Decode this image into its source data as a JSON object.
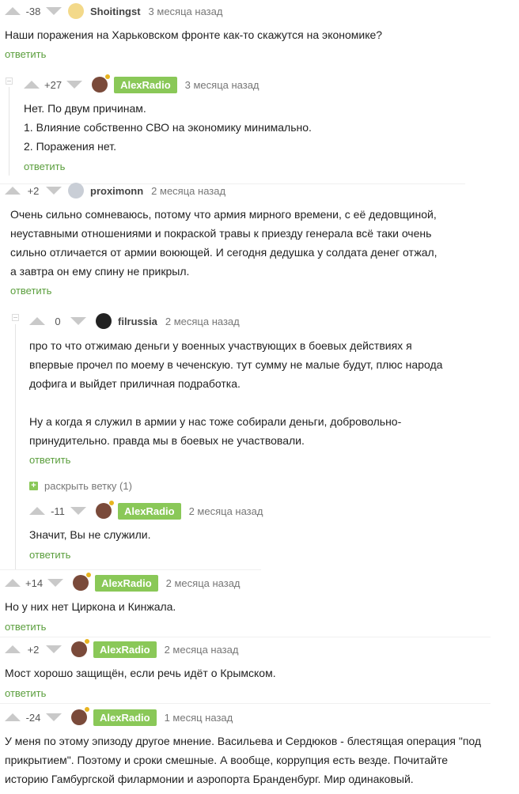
{
  "c1": {
    "rating": "-38",
    "user": "Shoitingst",
    "time": "3 месяца назад",
    "text": "Наши поражения на Харьковском фронте как-то скажутся на экономике?",
    "reply": "ответить"
  },
  "c2": {
    "rating": "+27",
    "user": "AlexRadio",
    "time": "3 месяца назад",
    "lines": [
      "Нет. По двум причинам.",
      "1. Влияние собственно СВО на экономику минимально.",
      "2. Поражения нет."
    ],
    "reply": "ответить"
  },
  "c3": {
    "rating": "+2",
    "user": "proximonn",
    "time": "2 месяца назад",
    "lines": [
      "Очень сильно сомневаюсь, потому что армия мирного времени, с её дедовщиной,",
      "неуставными отношениями и покраской травы к приезду генерала всё таки очень",
      "сильно отличается от армии воюющей. И сегодня дедушка у солдата денег отжал,",
      "а завтра он ему спину не прикрыл."
    ],
    "reply": "ответить"
  },
  "c4": {
    "rating": "0",
    "user": "filrussia",
    "time": "2 месяца назад",
    "lines": [
      "про то что отжимаю деньги у военных участвующих в боевых действиях я",
      "впервые прочел по моему в чеченскую. тут сумму не малые будут, плюс народа",
      "дофига и выйдет приличная подработка."
    ],
    "lines2": [
      "Ну а когда я служил в армии у нас тоже собирали деньги, добровольно-",
      "принудительно. правда мы в боевых не участвовали."
    ],
    "reply": "ответить",
    "expand": "раскрыть ветку (1)"
  },
  "c5": {
    "rating": "-11",
    "user": "AlexRadio",
    "time": "2 месяца назад",
    "text": "Значит, Вы не служили.",
    "reply": "ответить"
  },
  "c6": {
    "rating": "+14",
    "user": "AlexRadio",
    "time": "2 месяца назад",
    "text": "Но у них нет Циркона и Кинжала.",
    "reply": "ответить"
  },
  "c7": {
    "rating": "+2",
    "user": "AlexRadio",
    "time": "2 месяца назад",
    "text": "Мост хорошо защищён, если речь идёт о Крымском.",
    "reply": "ответить"
  },
  "c8": {
    "rating": "-24",
    "user": "AlexRadio",
    "time": "1 месяц назад",
    "lines": [
      "У меня по этому эпизоду другое мнение. Васильева и Сердюков - блестящая операция \"под",
      "прикрытием\". Поэтому и сроки смешные. А вообще, коррупция есть везде. Почитайте",
      "историю Гамбургской филармонии и аэропорта Бранденбург. Мир одинаковый."
    ]
  },
  "colors": {
    "accent": "#8ac858",
    "reply": "#5a9e3c"
  }
}
